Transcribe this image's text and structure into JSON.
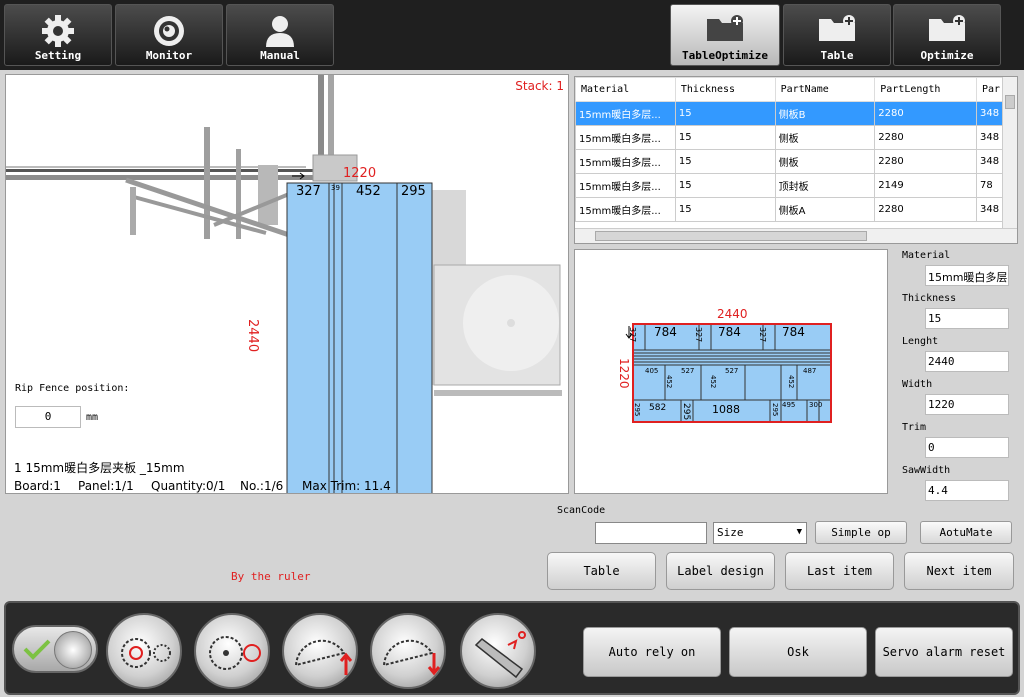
{
  "nav": {
    "setting": "Setting",
    "monitor": "Monitor",
    "manual": "Manual",
    "table_optimize": "TableOptimize",
    "table": "Table",
    "optimize": "Optimize"
  },
  "view": {
    "stack": "Stack: 1",
    "dim_top": "1220",
    "dim_side": "2440",
    "strips": [
      "327",
      "39",
      "452",
      "295"
    ],
    "rip_fence_label": "Rip Fence position:",
    "rip_fence_value": "0",
    "rip_fence_unit": "mm",
    "title_line": "1  15mm暖白多层夹板 _15mm",
    "board": "Board:1",
    "panel": "Panel:1/1",
    "quantity": "Quantity:0/1",
    "no": "No.:1/6",
    "max_trim": "Max Trim: 11.4"
  },
  "part_table": {
    "headers": [
      "Material",
      "Thickness",
      "PartName",
      "PartLength",
      "Par"
    ],
    "rows": [
      [
        "15mm暖白多层...",
        "15",
        "侧板B",
        "2280",
        "348"
      ],
      [
        "15mm暖白多层...",
        "15",
        "侧板",
        "2280",
        "348"
      ],
      [
        "15mm暖白多层...",
        "15",
        "侧板",
        "2280",
        "348"
      ],
      [
        "15mm暖白多层...",
        "15",
        "顶封板",
        "2149",
        "78"
      ],
      [
        "15mm暖白多层...",
        "15",
        "侧板A",
        "2280",
        "348"
      ]
    ],
    "selected_row": 0
  },
  "layout": {
    "length": "2440",
    "width": "1220",
    "row1": [
      "327",
      "784",
      "327",
      "784",
      "327",
      "784"
    ],
    "row3": [
      "405",
      "452",
      "527",
      "452",
      "527",
      "452",
      "487"
    ],
    "row4": [
      "295",
      "582",
      "295",
      "1088",
      "295",
      "495",
      "300"
    ]
  },
  "fields": {
    "material_label": "Material",
    "material_value": "15mm暖白多层夹",
    "thickness_label": "Thickness",
    "thickness_value": "15",
    "length_label": "Lenght",
    "length_value": "2440",
    "width_label": "Width",
    "width_value": "1220",
    "trim_label": "Trim",
    "trim_value": "0",
    "sawwidth_label": "SawWidth",
    "sawwidth_value": "4.4"
  },
  "scan": {
    "label": "ScanCode",
    "value": "",
    "size_select": "Size",
    "simple_op": "Simple op",
    "aoutumate": "AotuMate"
  },
  "actions": {
    "table": "Table",
    "label_design": "Label design",
    "last_item": "Last item",
    "next_item": "Next item"
  },
  "ruler_text": "By the ruler",
  "bottom": {
    "auto_rely_on": "Auto rely on",
    "osk": "Osk",
    "servo_alarm_reset": "Servo alarm reset"
  },
  "colors": {
    "panel_blue": "#99ccf5",
    "select_blue": "#3399ff",
    "dim_red": "#e02020"
  }
}
